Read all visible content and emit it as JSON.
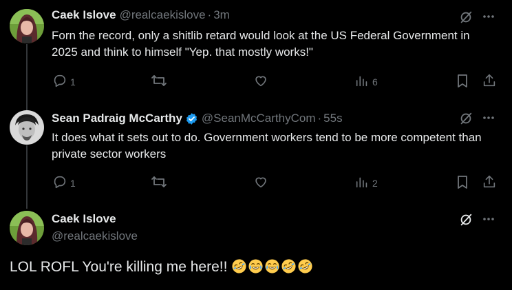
{
  "tweets": [
    {
      "name": "Caek Islove",
      "handle": "@realcaekislove",
      "time": "3m",
      "text": "Forn the record, only a shitlib retard would look at the US Federal Government in 2025 and think to himself \"Yep. that mostly works!\"",
      "replies": "1",
      "reposts": "",
      "likes": "",
      "views": "6"
    },
    {
      "name": "Sean Padraig McCarthy",
      "verified": true,
      "handle": "@SeanMcCarthyCom",
      "time": "55s",
      "text": "It does what it sets out to do. Government workers tend to be more competent than private sector workers",
      "replies": "1",
      "reposts": "",
      "likes": "",
      "views": "2"
    }
  ],
  "main_tweet": {
    "name": "Caek Islove",
    "handle": "@realcaekislove",
    "text": "LOL ROFL You're killing me here!!",
    "emojis": [
      "rolling-on-floor-laughing",
      "tears-of-joy",
      "tears-of-joy",
      "rolling-on-floor-laughing",
      "rolling-on-floor-laughing"
    ]
  },
  "separator": "·",
  "colors": {
    "background": "#000000",
    "text": "#e7e9ea",
    "secondary": "#71767b",
    "verified": "#1d9bf0",
    "thread_line": "#333639"
  }
}
